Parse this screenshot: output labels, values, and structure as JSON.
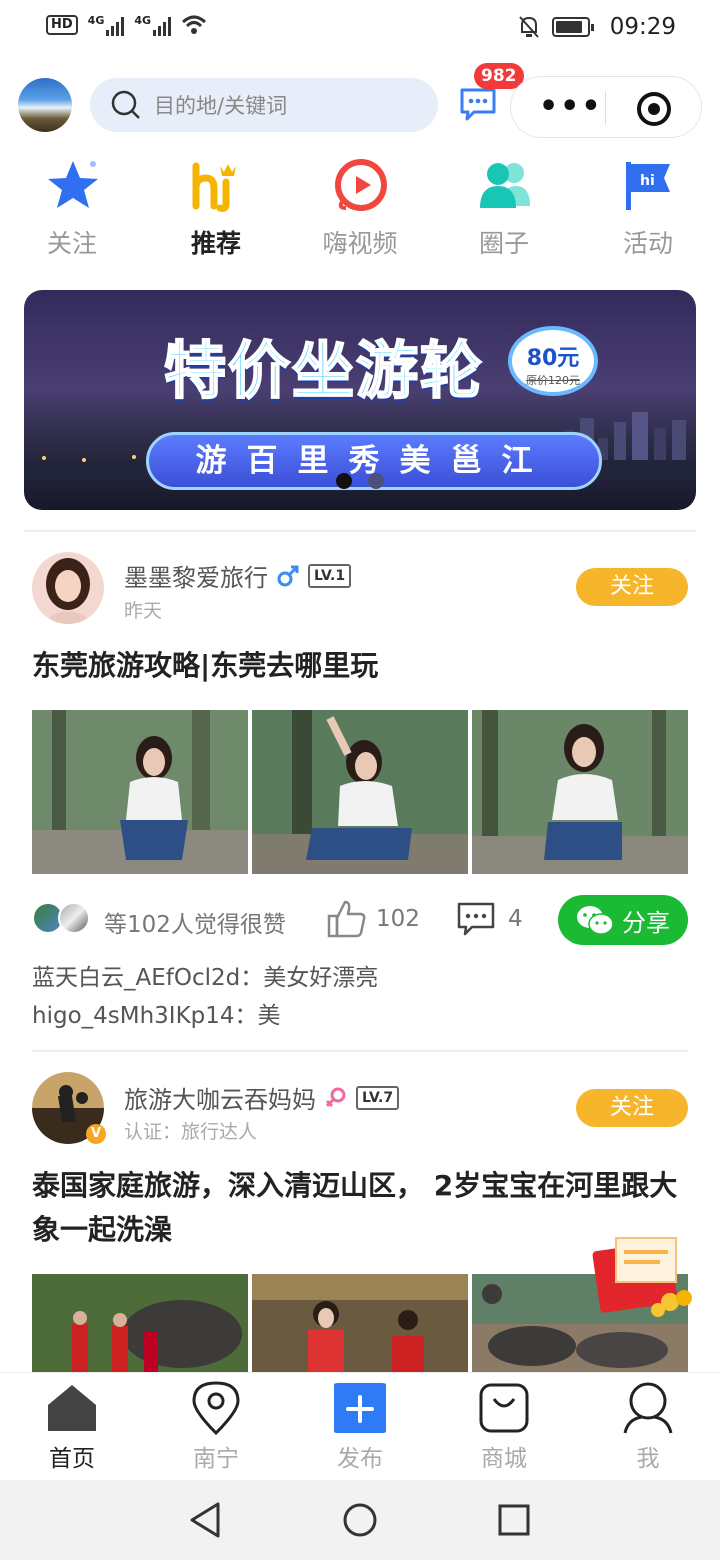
{
  "status_bar": {
    "left_items": [
      "HD",
      "4G",
      "4G"
    ],
    "time": "09:29"
  },
  "header": {
    "search_placeholder": "目的地/关键词",
    "message_badge": "982"
  },
  "tabs": [
    {
      "label": "关注",
      "icon": "star-icon",
      "active": false
    },
    {
      "label": "推荐",
      "icon": "hi-logo-icon",
      "active": true
    },
    {
      "label": "嗨视频",
      "icon": "video-play-icon",
      "active": false
    },
    {
      "label": "圈子",
      "icon": "group-icon",
      "active": false
    },
    {
      "label": "活动",
      "icon": "flag-icon",
      "active": false
    }
  ],
  "banner": {
    "title": "特价坐游轮",
    "price": "80元",
    "original_price": "原价120元",
    "subtitle": "游百里秀美邕江",
    "slide_index": 1,
    "slide_count": 2
  },
  "posts": [
    {
      "author": "墨墨黎爱旅行",
      "gender": "male",
      "level": "LV.1",
      "subline": "昨天",
      "follow_label": "关注",
      "title": "东莞旅游攻略|东莞去哪里玩",
      "likes_text": "等102人觉得很赞",
      "like_count": "102",
      "comment_count": "4",
      "share_label": "分享",
      "comments": [
        {
          "user": "蓝天白云_AEfOcl2d",
          "text": "美女好漂亮"
        },
        {
          "user": "higo_4sMh3IKp14",
          "text": "美"
        }
      ]
    },
    {
      "author": "旅游大咖云吞妈妈",
      "gender": "female",
      "level": "LV.7",
      "subline": "认证：旅行达人",
      "follow_label": "关注",
      "title": "泰国家庭旅游，深入清迈山区， 2岁宝宝在河里跟大象一起洗澡"
    }
  ],
  "bottom_nav": [
    {
      "label": "首页",
      "icon": "home-icon",
      "active": true
    },
    {
      "label": "南宁",
      "icon": "location-pin-icon",
      "active": false
    },
    {
      "label": "发布",
      "icon": "plus-icon",
      "active": false
    },
    {
      "label": "商城",
      "icon": "shopping-bag-icon",
      "active": false
    },
    {
      "label": "我",
      "icon": "user-icon",
      "active": false
    }
  ],
  "colors": {
    "accent_blue": "#3a7cf5",
    "follow_orange": "#f7b52c",
    "share_green": "#1bba34",
    "badge_red": "#f23a3a"
  }
}
